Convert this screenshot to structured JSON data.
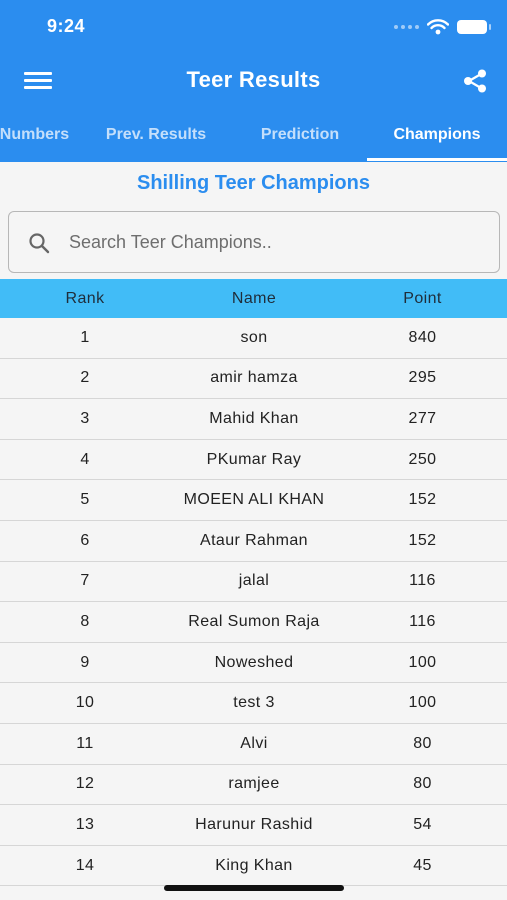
{
  "status_bar": {
    "time": "9:24"
  },
  "app_bar": {
    "title": "Teer Results"
  },
  "tabs": [
    {
      "label": "Common Numbers",
      "active": false
    },
    {
      "label": "Prev. Results",
      "active": false
    },
    {
      "label": "Prediction",
      "active": false
    },
    {
      "label": "Champions",
      "active": true
    }
  ],
  "page": {
    "heading": "Shilling Teer Champions"
  },
  "search": {
    "placeholder": "Search Teer Champions.."
  },
  "table": {
    "columns": [
      "Rank",
      "Name",
      "Point"
    ],
    "rows": [
      {
        "rank": "1",
        "name": "son",
        "point": "840"
      },
      {
        "rank": "2",
        "name": "amir hamza",
        "point": "295"
      },
      {
        "rank": "3",
        "name": "Mahid Khan",
        "point": "277"
      },
      {
        "rank": "4",
        "name": "PKumar Ray",
        "point": "250"
      },
      {
        "rank": "5",
        "name": "MOEEN ALI KHAN",
        "point": "152"
      },
      {
        "rank": "6",
        "name": "Ataur Rahman",
        "point": "152"
      },
      {
        "rank": "7",
        "name": "jalal",
        "point": "116"
      },
      {
        "rank": "8",
        "name": "Real Sumon Raja",
        "point": "116"
      },
      {
        "rank": "9",
        "name": "Noweshed",
        "point": "100"
      },
      {
        "rank": "10",
        "name": "test 3",
        "point": "100"
      },
      {
        "rank": "11",
        "name": "Alvi",
        "point": "80"
      },
      {
        "rank": "12",
        "name": "ramjee",
        "point": "80"
      },
      {
        "rank": "13",
        "name": "Harunur Rashid",
        "point": "54"
      },
      {
        "rank": "14",
        "name": "King Khan",
        "point": "45"
      }
    ]
  },
  "colors": {
    "primary": "#2b8def",
    "table_header": "#41bcf7",
    "background": "#f5f5f5"
  }
}
